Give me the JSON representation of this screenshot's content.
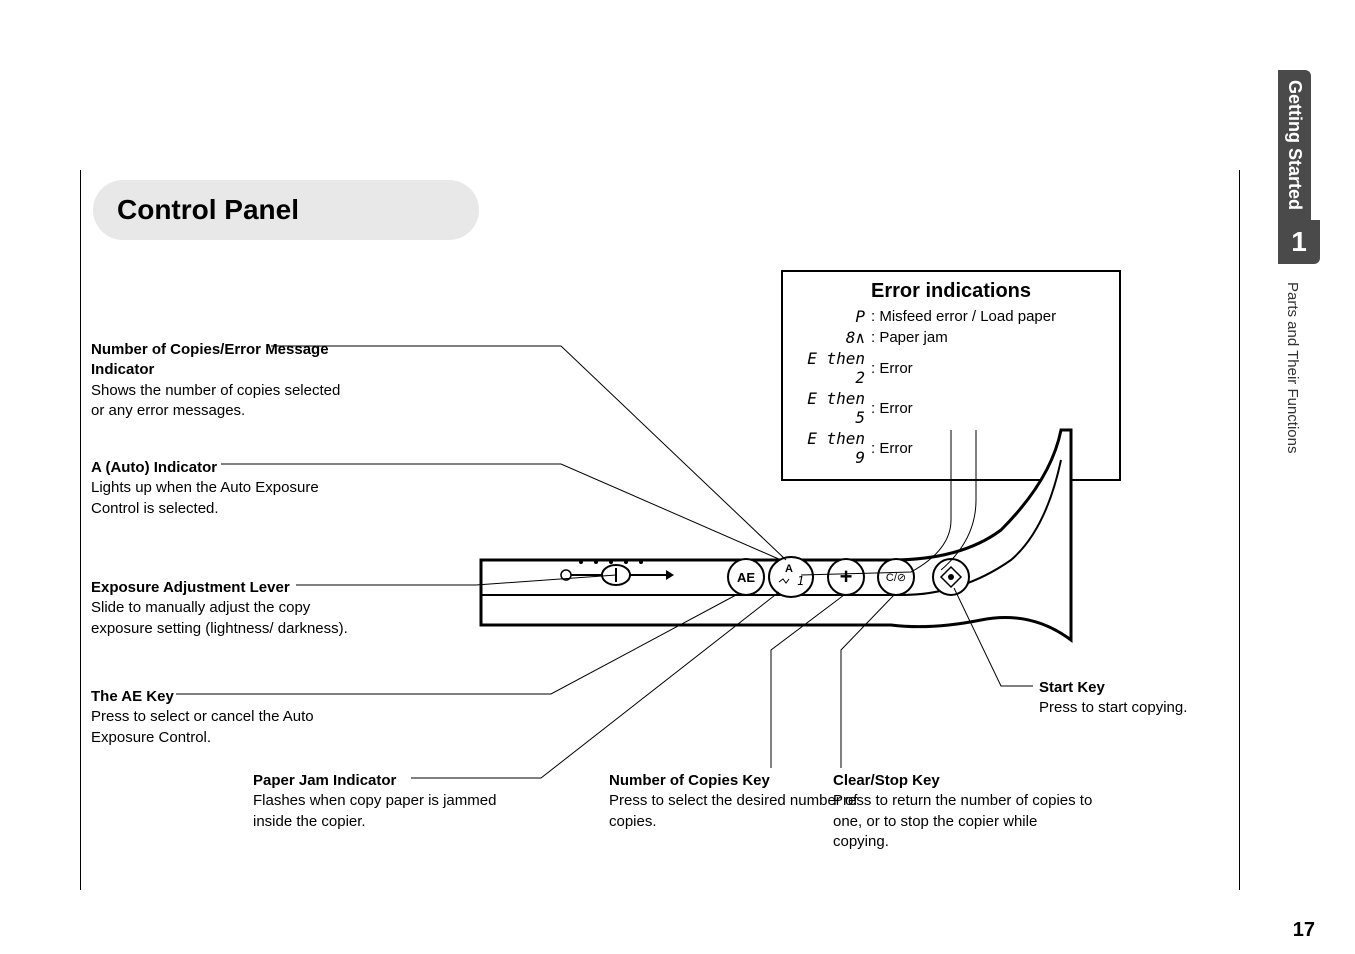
{
  "page": {
    "section_tab": "Getting Started",
    "chapter_num": "1",
    "sub_tab": "Parts and Their Functions",
    "page_number": "17",
    "title": "Control Panel"
  },
  "callouts": {
    "copies_indicator": {
      "title": "Number of Copies/Error Message Indicator",
      "body": "Shows the number of copies selected or any error messages."
    },
    "auto_indicator": {
      "title": "A (Auto) Indicator",
      "body": "Lights up when the Auto Exposure Control is selected."
    },
    "exposure_lever": {
      "title": "Exposure Adjustment Lever",
      "body": "Slide to manually adjust the copy exposure setting (lightness/ darkness)."
    },
    "ae_key": {
      "title": "The AE Key",
      "body": "Press to select or cancel the Auto Exposure Control."
    },
    "paper_jam_ind": {
      "title": "Paper Jam Indicator",
      "body": "Flashes when copy paper is jammed inside the copier."
    },
    "copies_key": {
      "title": "Number of Copies Key",
      "body": "Press to select the desired number of copies."
    },
    "clear_stop": {
      "title": "Clear/Stop Key",
      "body": "Press to return the number of copies to one, or to stop the copier while copying."
    },
    "start_key": {
      "title": "Start Key",
      "body": "Press to start copying."
    }
  },
  "error_box": {
    "header": "Error indications",
    "items": [
      {
        "symbol": "P",
        "desc": ": Misfeed error / Load paper"
      },
      {
        "symbol": "8∧",
        "desc": ": Paper jam"
      },
      {
        "symbol": "E then 2",
        "desc": ": Error"
      },
      {
        "symbol": "E then 5",
        "desc": ": Error"
      },
      {
        "symbol": "E then 9",
        "desc": ": Error"
      }
    ]
  },
  "panel": {
    "ae_label": "AE",
    "auto_label": "A",
    "digit": "1",
    "plus": "+",
    "clear": "C/⊘",
    "start": "⬧"
  }
}
